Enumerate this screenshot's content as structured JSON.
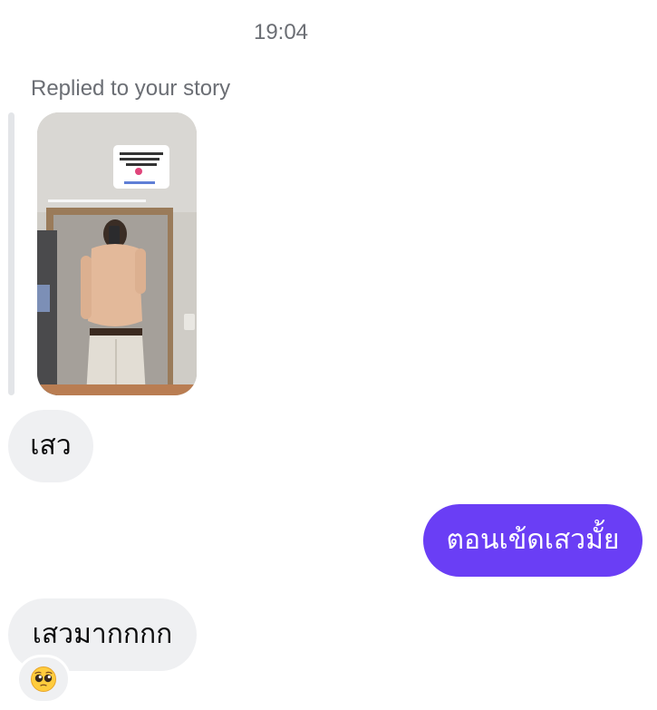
{
  "header": {
    "timestamp": "19:04"
  },
  "story_reply": {
    "label": "Replied to your story",
    "thumbnail_icon": "story-photo-thumbnail"
  },
  "messages": [
    {
      "direction": "incoming",
      "text": "เสว"
    },
    {
      "direction": "outgoing",
      "text": "ตอนเข้ดเสวมั้ย"
    },
    {
      "direction": "incoming",
      "text": "เสวมากกกก"
    }
  ],
  "reaction": {
    "icon": "pleading-face-emoji"
  },
  "colors": {
    "incoming_bubble": "#eff0f2",
    "outgoing_bubble": "#6a3ef5",
    "meta_text": "#6b6e74"
  }
}
